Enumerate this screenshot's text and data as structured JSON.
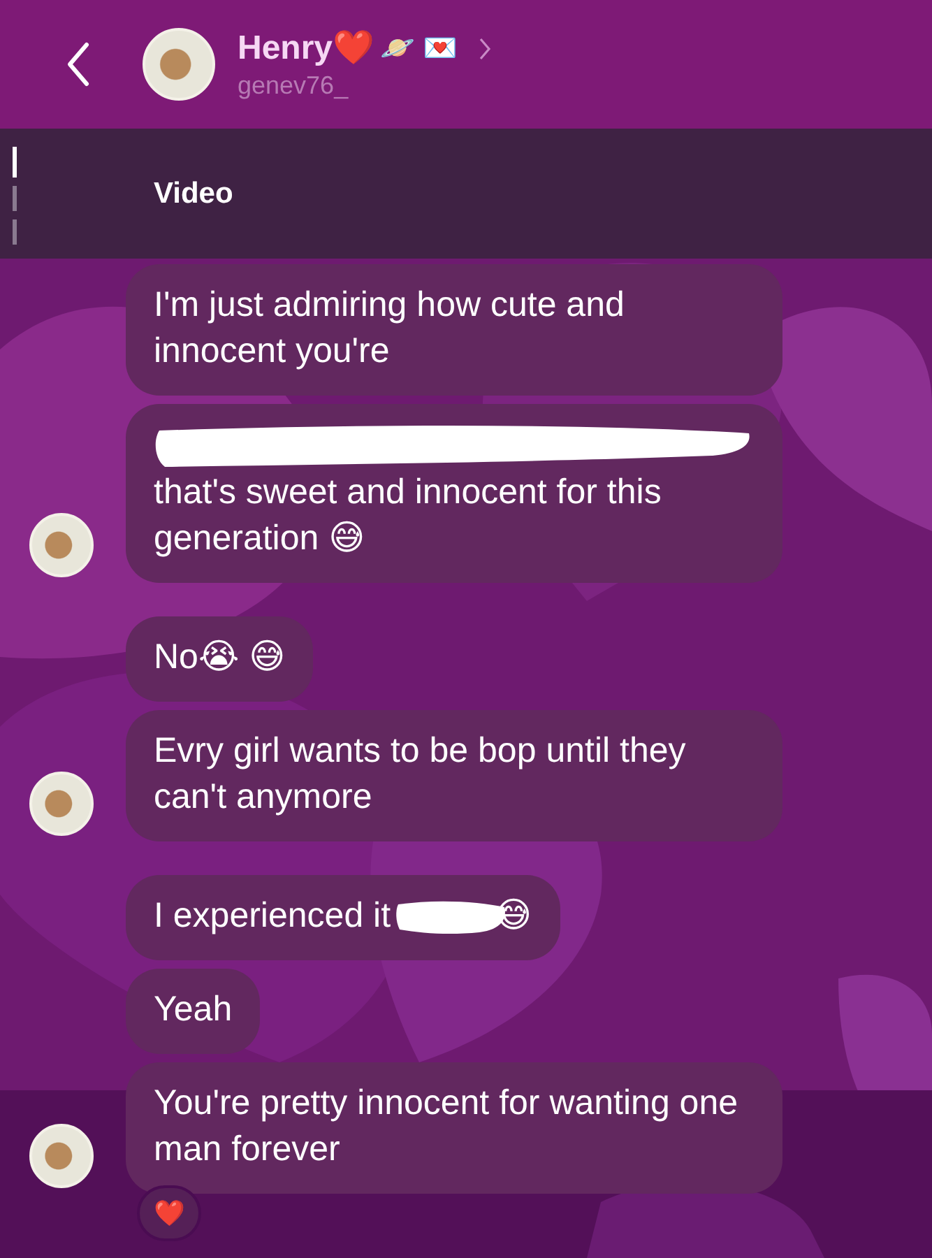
{
  "header": {
    "name": "Henry❤️",
    "name_emojis": "🪐 💌",
    "username": "genev76_"
  },
  "reply_preview": {
    "label": "Video"
  },
  "groups": [
    {
      "messages": [
        {
          "text": "I'm just admiring how cute and innocent you're"
        },
        {
          "text": "that's sweet and innocent for this generation 😅",
          "scribble_above": true
        }
      ]
    },
    {
      "messages": [
        {
          "text": "No😭 😅"
        },
        {
          "text": "Evry girl wants to be bop until they can't anymore"
        }
      ]
    },
    {
      "messages": [
        {
          "text": "I experienced it",
          "scribble_after": true,
          "tail": "😅"
        },
        {
          "text": "Yeah"
        },
        {
          "text": "You're pretty innocent for wanting one man forever",
          "reaction": "❤️"
        }
      ]
    }
  ]
}
